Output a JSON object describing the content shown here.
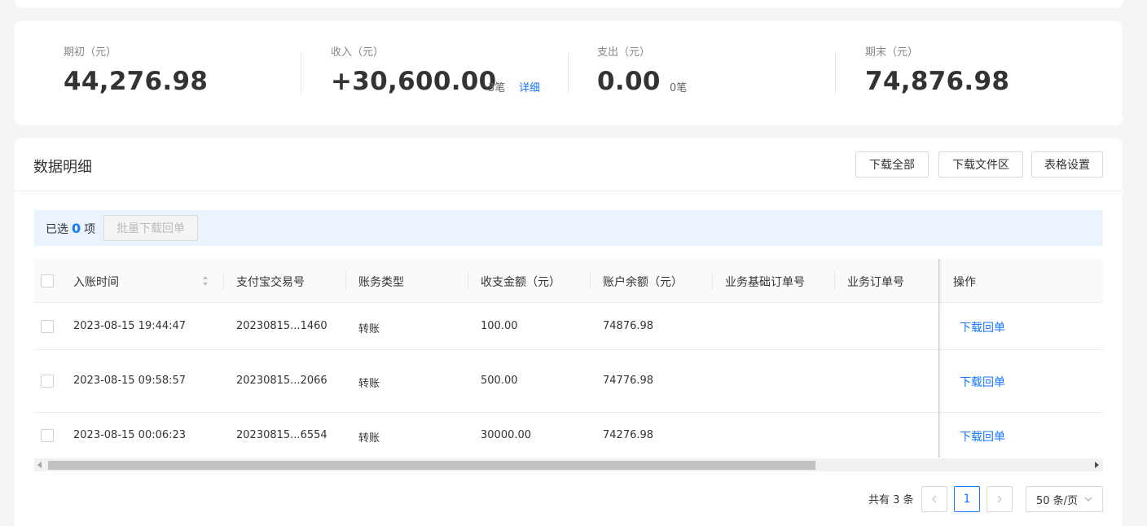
{
  "summary": {
    "opening": {
      "label": "期初（元）",
      "value": "44,276.98"
    },
    "income": {
      "label": "收入（元）",
      "value": "+30,600.00",
      "count": "3笔",
      "detail_link": "详细"
    },
    "expense": {
      "label": "支出（元）",
      "value": "0.00",
      "count": "0笔"
    },
    "closing": {
      "label": "期末（元）",
      "value": "74,876.98"
    }
  },
  "detail": {
    "title": "数据明细",
    "buttons": {
      "download_all": "下载全部",
      "download_area": "下载文件区",
      "table_settings": "表格设置"
    }
  },
  "selection": {
    "prefix": "已选",
    "count": "0",
    "suffix": "项",
    "batch_button": "批量下载回单"
  },
  "table": {
    "columns": [
      "入账时间",
      "支付宝交易号",
      "账务类型",
      "收支金额（元）",
      "账户余额（元）",
      "业务基础订单号",
      "业务订单号",
      "操作"
    ],
    "rows": [
      {
        "time": "2023-08-15 19:44:47",
        "trade_no": "20230815...1460",
        "type": "转账",
        "amount": "100.00",
        "balance": "74876.98",
        "base_order": "",
        "order": "",
        "action": "下载回单"
      },
      {
        "time": "2023-08-15 09:58:57",
        "trade_no": "20230815...2066",
        "type": "转账",
        "amount": "500.00",
        "balance": "74776.98",
        "base_order": "",
        "order": "",
        "action": "下载回单"
      },
      {
        "time": "2023-08-15 00:06:23",
        "trade_no": "20230815...6554",
        "type": "转账",
        "amount": "30000.00",
        "balance": "74276.98",
        "base_order": "",
        "order": "",
        "action": "下载回单"
      }
    ]
  },
  "pagination": {
    "total": "共有 3 条",
    "current_page": "1",
    "page_size": "50 条/页",
    "prev_icon": "chevron-left-icon",
    "next_icon": "chevron-right-icon"
  },
  "colors": {
    "accent": "#1677ff",
    "selection_bg": "#ebf3ff",
    "page_bg": "#f5f5f5"
  }
}
